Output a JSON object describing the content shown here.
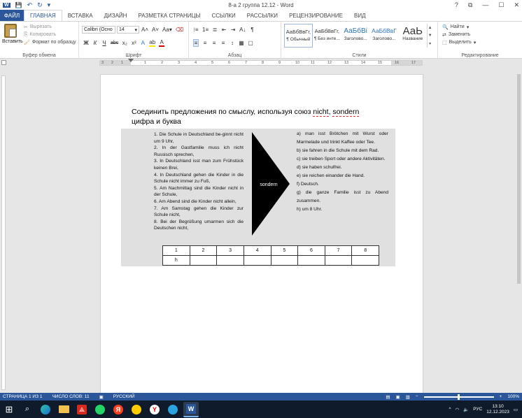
{
  "window": {
    "title": "8-а 2 группа 12.12 - Word",
    "help": "?",
    "minimize": "—",
    "maximize": "☐",
    "close": "✕",
    "ribbon_display": "⧉"
  },
  "qat": {
    "save": "💾",
    "undo": "↶",
    "redo": "↻",
    "customize": "▾"
  },
  "tabs": [
    {
      "label": "ФАЙЛ"
    },
    {
      "label": "ГЛАВНАЯ"
    },
    {
      "label": "ВСТАВКА"
    },
    {
      "label": "ДИЗАЙН"
    },
    {
      "label": "РАЗМЕТКА СТРАНИЦЫ"
    },
    {
      "label": "ССЫЛКИ"
    },
    {
      "label": "РАССЫЛКИ"
    },
    {
      "label": "РЕЦЕНЗИРОВАНИЕ"
    },
    {
      "label": "ВИД"
    }
  ],
  "clipboard": {
    "paste": "Вставить",
    "cut": "Вырезать",
    "copy": "Копировать",
    "format_painter": "Формат по образцу",
    "label": "Буфер обмена"
  },
  "font": {
    "name": "Calibri (Осно",
    "size": "14",
    "label": "Шрифт",
    "grow": "A˄",
    "shrink": "A˅",
    "case": "Aa▾",
    "clear": "⌫",
    "bold": "Ж",
    "italic": "К",
    "underline": "Ч",
    "strike": "abc",
    "sub": "x₂",
    "sup": "x²",
    "effects": "A",
    "highlight": "ab",
    "color": "A"
  },
  "paragraph": {
    "label": "Абзац",
    "bullets": "⁝≡",
    "numbering": "1≡",
    "multilevel": "≣",
    "dec_indent": "⇤",
    "inc_indent": "⇥",
    "sort": "A↓",
    "marks": "¶",
    "align_left": "≡",
    "center": "≡",
    "align_right": "≡",
    "justify": "≡",
    "spacing": "↕",
    "shading": "▦",
    "borders": "▢"
  },
  "styles": {
    "label": "Стили",
    "items": [
      {
        "preview": "АаБбВвГг,",
        "name": "¶ Обычный"
      },
      {
        "preview": "АаБбВвГг,",
        "name": "¶ Без инте..."
      },
      {
        "preview": "АаБбВі",
        "name": "Заголово..."
      },
      {
        "preview": "АаБбВвГ",
        "name": "Заголово..."
      },
      {
        "preview": "АаЬ",
        "name": "Название"
      }
    ]
  },
  "editing": {
    "label": "Редактирование",
    "find": "Найти",
    "replace": "Заменить",
    "select": "Выделить"
  },
  "ruler": {
    "ticks": [
      "3",
      "2",
      "1",
      "1",
      "2",
      "3",
      "4",
      "5",
      "6",
      "7",
      "8",
      "9",
      "10",
      "11",
      "12",
      "13",
      "14",
      "15",
      "16",
      "17"
    ]
  },
  "document": {
    "line1_before": "Соединить предложения по смыслу, используя союз ",
    "word_nicht": "nicht",
    "comma": ", ",
    "word_sondern": "sondern",
    "line2": "цифра и буква",
    "left_items": [
      "1. Die Schule in Deutschland be-ginnt nicht um 9 Uhr,",
      "2. In der Gastfamilie muss ich nicht Russisch sprechen,",
      "3. In Deutschland isst man zum Frühstück keinen Brei,",
      "4. In Deutschland gehen die Kinder in die Schule nicht immer zu Fuß,",
      "5. Am Nachmittag sind die Kinder nicht in der Schule,",
      "6. Am Abend sind die Kinder nicht allein,",
      "7. Am Samstag gehen die Kinder zur Schule nicht,",
      "8. Bei der Begrüßung umarmen sich die Deutschen nicht,"
    ],
    "arrow_label": "sondern",
    "right_items": [
      "a) man isst Brötchen mit Wurst oder Marmelade und trinkt Kaffee oder Tee.",
      "b) sie fahren in die Schule mit dem Rad.",
      "c) sie treiben Sport oder andere Aktivitäten.",
      "d) sie haben schulfrei.",
      "e) sie reichen einander die Hand.",
      "f) Deutsch.",
      "g) die ganze Familie isst zu Abend zusammen.",
      "h) um 8 Uhr."
    ],
    "table_header": [
      "1",
      "2",
      "3",
      "4",
      "5",
      "6",
      "7",
      "8"
    ],
    "table_answers": [
      "h",
      "",
      "",
      "",
      "",
      "",
      "",
      ""
    ]
  },
  "status": {
    "page": "СТРАНИЦА 1 ИЗ 1",
    "words": "ЧИСЛО СЛОВ: 11",
    "language": "РУССКИЙ",
    "zoom_out": "−",
    "zoom_in": "+",
    "zoom": "100%"
  },
  "taskbar": {
    "start": "⊞",
    "search": "⌕",
    "tray_up": "^",
    "tray_lang": "РУС",
    "time": "13:10",
    "date": "12.12.2023"
  },
  "colors": {
    "word_blue": "#2b579a",
    "taskbar": "#0f1b2b",
    "arrow_fill": "#000000"
  }
}
